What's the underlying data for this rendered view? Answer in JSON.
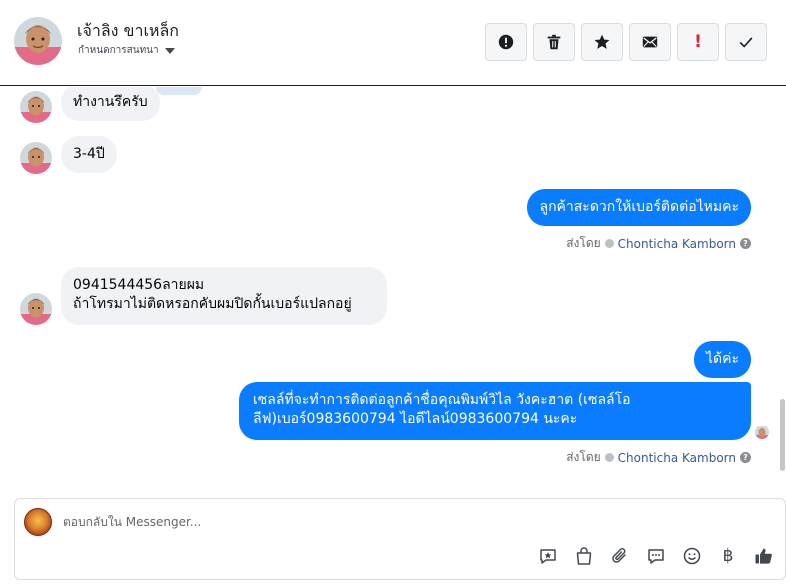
{
  "header": {
    "contact_name": "เจ้าลิง ขาเหล็ก",
    "assign_label": "กำหนดการสนทนา",
    "actions": [
      {
        "name": "spam-button",
        "icon": "alert-circle-icon"
      },
      {
        "name": "delete-button",
        "icon": "trash-icon"
      },
      {
        "name": "star-button",
        "icon": "star-icon"
      },
      {
        "name": "mark-unread-button",
        "icon": "envelope-icon"
      },
      {
        "name": "follow-up-button",
        "icon": "exclamation-icon",
        "glyph": "!"
      },
      {
        "name": "mark-done-button",
        "icon": "check-icon"
      }
    ]
  },
  "messages": {
    "m1": "ทำงานรึครับ",
    "m2": "3-4ปี",
    "m3": "ลูกค้าสะดวกให้เบอร์ติดต่อไหมคะ",
    "m4_line1": "0941544456ลายผม",
    "m4_line2": "ถ้าโทรมาไม่ติดหรอกคับผมปิดกั้นเบอร์แปลกอยู่",
    "m5": "ได้ค่ะ",
    "m6_line1": "เซลล์ที่จะทำการติดต่อลูกค้าชื่อคุณพิมพ์วิไล วังคะฮาต (เซลล์โอ",
    "m6_line2": "ลีฟ)เบอร์0983600794 ไอดีไลน์0983600794 นะคะ"
  },
  "sent_by": {
    "prefix": "ส่งโดย",
    "agent": "Chonticha Kamborn",
    "help": "?"
  },
  "composer": {
    "placeholder": "ตอบกลับใน Messenger...",
    "tools": [
      "saved-reply-icon",
      "shop-bag-icon",
      "paperclip-icon",
      "comment-icon",
      "emoji-icon",
      "baht-icon",
      "thumbs-up-icon"
    ],
    "baht_glyph": "฿"
  },
  "colors": {
    "accent": "#0a7cff",
    "incoming_bubble": "#f0f2f5",
    "agent_link": "#385898"
  }
}
